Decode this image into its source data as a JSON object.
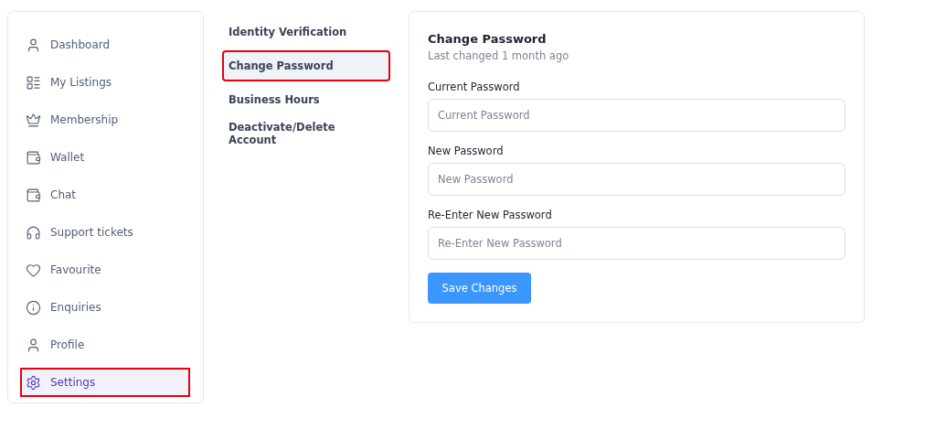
{
  "sidebar": {
    "items": [
      {
        "label": "Dashboard",
        "selected": false
      },
      {
        "label": "My Listings",
        "selected": false
      },
      {
        "label": "Membership",
        "selected": false
      },
      {
        "label": "Wallet",
        "selected": false
      },
      {
        "label": "Chat",
        "selected": false
      },
      {
        "label": "Support tickets",
        "selected": false
      },
      {
        "label": "Favourite",
        "selected": false
      },
      {
        "label": "Enquiries",
        "selected": false
      },
      {
        "label": "Profile",
        "selected": false
      },
      {
        "label": "Settings",
        "selected": true
      }
    ]
  },
  "settings_menu": {
    "items": [
      {
        "label": "Identity Verification",
        "selected": false
      },
      {
        "label": "Change Password",
        "selected": true
      },
      {
        "label": "Business Hours",
        "selected": false
      },
      {
        "label": "Deactivate/Delete Account",
        "selected": false
      }
    ]
  },
  "form": {
    "title": "Change Password",
    "subtitle": "Last changed 1 month ago",
    "fields": [
      {
        "label": "Current Password",
        "placeholder": "Current Password"
      },
      {
        "label": "New Password",
        "placeholder": "New Password"
      },
      {
        "label": "Re-Enter New Password",
        "placeholder": "Re-Enter New Password"
      }
    ],
    "submit": "Save Changes"
  }
}
